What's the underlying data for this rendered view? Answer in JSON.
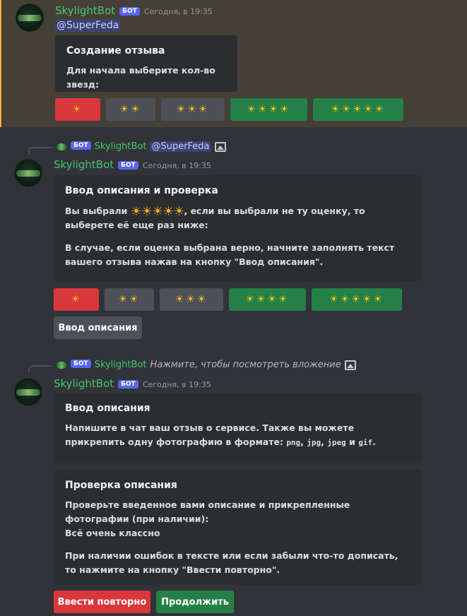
{
  "colors": {
    "background": "#313338",
    "highlight": "#444037",
    "highlight_border": "#f0b232",
    "author": "#46c46e",
    "bot_tag": "#5865f2",
    "danger": "#da373c",
    "secondary": "#4e5058",
    "success": "#248046"
  },
  "messages": [
    {
      "author": "SkylightBot",
      "tag": "БОТ",
      "timestamp": "Сегодня, в 19:35",
      "mention": "@SuperFeda",
      "embed": {
        "title": "Создание отзыва",
        "description": "Для начала выберите кол-во звезд:"
      },
      "buttons": [
        "☀",
        "☀☀",
        "☀☀☀",
        "☀☀☀☀",
        "☀☀☀☀☀"
      ]
    },
    {
      "reply": {
        "author": "SkylightBot",
        "mention": "@SuperFeda",
        "icon": "image-icon"
      },
      "author": "SkylightBot",
      "tag": "БОТ",
      "timestamp": "Сегодня, в 19:35",
      "embed": {
        "title": "Ввод описания и проверка",
        "p1_before": "Вы выбрали ",
        "p1_stars": "☀☀☀☀☀",
        "p1_after": ", если вы выбрали не ту оценку, то выберете её еще раз ниже:",
        "p2": "В случае, если оценка выбрана верно, начните заполнять текст вашего отзыва нажав на кнопку \"Ввод описания\"."
      },
      "buttons": [
        "☀",
        "☀☀",
        "☀☀☀",
        "☀☀☀☀",
        "☀☀☀☀☀"
      ],
      "action_button": "Ввод описания"
    },
    {
      "reply": {
        "author": "SkylightBot",
        "text": "Нажмите, чтобы посмотреть вложение",
        "icon": "image-icon"
      },
      "author": "SkylightBot",
      "tag": "БОТ",
      "timestamp": "Сегодня, в 19:35",
      "embed1": {
        "title": "Ввод описания",
        "text_a": "Напишите в чат ваш отзыв о сервисе. Также вы можете прикрепить ",
        "text_bold": "одну",
        "text_b": " фотографию в формате: ",
        "code1": "png",
        "sep1": ", ",
        "code2": "jpg",
        "sep2": ", ",
        "code3": "jpeg",
        "sep3": " и ",
        "code4": "gif",
        "end": "."
      },
      "embed2": {
        "title": "Проверка описания",
        "p1": "Проверьте введенное вами описание и прикрепленные фотографии (при наличии):",
        "p1b": "Всё очень классно",
        "p2": "При наличии ошибок в тексте или если забыли что-то дописать, то нажмите на кнопку \"Ввести повторно\"."
      },
      "retry_button": "Ввести повторно",
      "continue_button": "Продолжить"
    }
  ]
}
